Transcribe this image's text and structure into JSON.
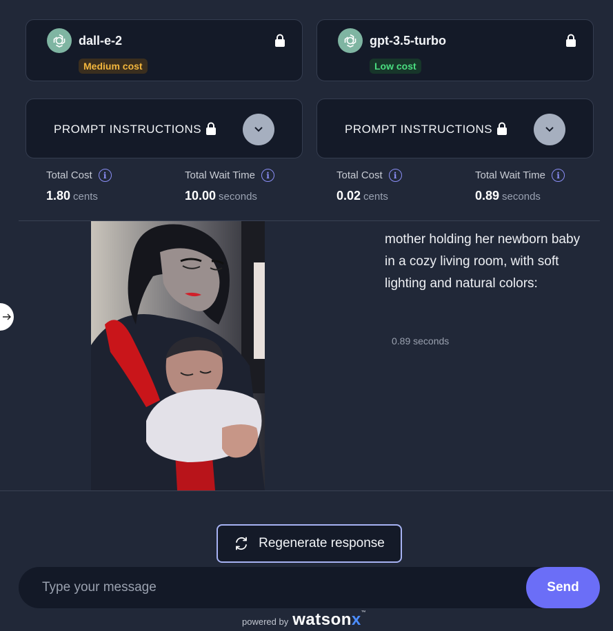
{
  "models": [
    {
      "name": "dall-e-2",
      "cost_badge": "Medium cost",
      "icon": "openai-logo-icon"
    },
    {
      "name": "gpt-3.5-turbo",
      "cost_badge": "Low cost",
      "icon": "openai-logo-icon"
    }
  ],
  "prompt_panels": [
    {
      "label": "PROMPT INSTRUCTIONS"
    },
    {
      "label": "PROMPT INSTRUCTIONS"
    }
  ],
  "stats": [
    {
      "total_cost_label": "Total Cost",
      "total_cost_value": "1.80",
      "total_cost_unit": "cents",
      "wait_label": "Total Wait Time",
      "wait_value": "10.00",
      "wait_unit": "seconds"
    },
    {
      "total_cost_label": "Total Cost",
      "total_cost_value": "0.02",
      "total_cost_unit": "cents",
      "wait_label": "Total Wait Time",
      "wait_value": "0.89",
      "wait_unit": "seconds"
    }
  ],
  "response": {
    "text": "mother holding her newborn baby in a cozy living room, with soft lighting and natural colors:",
    "time": "0.89 seconds"
  },
  "regenerate_label": "Regenerate response",
  "composer": {
    "placeholder": "Type your message",
    "send_label": "Send"
  },
  "footer": {
    "powered_by": "powered by",
    "brand": "watson",
    "brand_x": "x",
    "tm": "™"
  },
  "colors": {
    "background": "#212838",
    "card": "#141a28",
    "accent": "#6b6ef7",
    "medium_cost": "#f2b63d",
    "low_cost": "#4ade80"
  }
}
